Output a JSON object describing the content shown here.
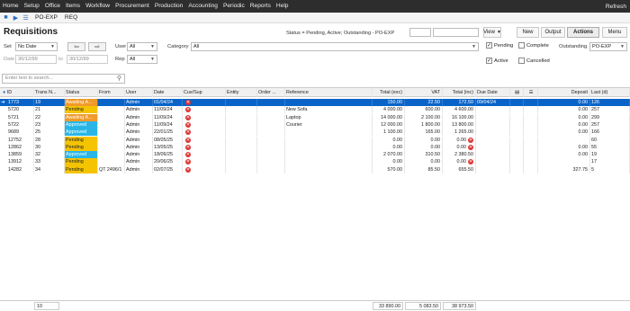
{
  "menubar": {
    "items": [
      "Home",
      "Setup",
      "Office",
      "Items",
      "Workflow",
      "Procurement",
      "Production",
      "Accounting",
      "Periodic",
      "Reports",
      "Help"
    ],
    "refresh": "Refresh"
  },
  "tabs": [
    "PO-EXP",
    "REQ"
  ],
  "header": {
    "title": "Requisitions",
    "status": "Status = Pending, Active; Outstanding - PO-EXP",
    "view_label": "View",
    "new_label": "New",
    "output_label": "Output",
    "actions_label": "Actions",
    "menu_label": "Menu"
  },
  "filters": {
    "set_label": "Set",
    "set_value": "No Date",
    "date_label": "Date",
    "date_from": "30/12/99",
    "to_label": "to",
    "date_to": "30/12/99",
    "user_label": "User",
    "user_value": "All",
    "rep_label": "Rep",
    "rep_value": "All",
    "category_label": "Category",
    "category_value": "All",
    "pending_label": "Pending",
    "pending_checked": true,
    "complete_label": "Complete",
    "complete_checked": false,
    "active_label": "Active",
    "active_checked": true,
    "cancelled_label": "Cancelled",
    "cancelled_checked": false,
    "outstanding_label": "Outstanding",
    "outstanding_value": "PO-EXP"
  },
  "search": {
    "placeholder": "Enter text to search..."
  },
  "columns": [
    "ID",
    "Trans N...",
    "Status",
    "From",
    "User",
    "Date",
    "Cus/Sup",
    "Entity",
    "Order ...",
    "Reference",
    "Total (exc)",
    "VAT",
    "Total (inc)",
    "Due Date",
    "",
    "",
    "Deposit",
    "Last (d)"
  ],
  "rows": [
    {
      "id": "1773",
      "trans": "19",
      "status": "Awaiting A...",
      "status_type": "awaiting",
      "from": "",
      "user": "Admin",
      "date": "01/04/24",
      "cus": true,
      "entity": "",
      "order": "",
      "reference": "",
      "exc": "150.00",
      "vat": "22.50",
      "inc": "172.50",
      "due": "09/04/24",
      "deposit": "0.00",
      "last": "126",
      "selected": true,
      "due_icon": false
    },
    {
      "id": "5720",
      "trans": "21",
      "status": "Pending",
      "status_type": "pending",
      "from": "",
      "user": "Admin",
      "date": "11/09/24",
      "cus": true,
      "entity": "",
      "order": "",
      "reference": "New Sofa",
      "exc": "4 000.00",
      "vat": "600.00",
      "inc": "4 600.00",
      "due": "",
      "deposit": "0.00",
      "last": "257",
      "selected": false,
      "due_icon": false
    },
    {
      "id": "5721",
      "trans": "22",
      "status": "Awaiting A...",
      "status_type": "awaiting",
      "from": "",
      "user": "Admin",
      "date": "11/09/24",
      "cus": true,
      "entity": "",
      "order": "",
      "reference": "Laptop",
      "exc": "14 000.00",
      "vat": "2 100.00",
      "inc": "16 100.00",
      "due": "",
      "deposit": "0.00",
      "last": "299",
      "selected": false,
      "due_icon": false
    },
    {
      "id": "5722",
      "trans": "23",
      "status": "Approved",
      "status_type": "approved",
      "from": "",
      "user": "Admin",
      "date": "11/09/24",
      "cus": true,
      "entity": "",
      "order": "",
      "reference": "Courier",
      "exc": "12 000.00",
      "vat": "1 800.00",
      "inc": "13 800.00",
      "due": "",
      "deposit": "0.00",
      "last": "257",
      "selected": false,
      "due_icon": false
    },
    {
      "id": "9689",
      "trans": "25",
      "status": "Approved",
      "status_type": "approved",
      "from": "",
      "user": "Admin",
      "date": "22/01/25",
      "cus": true,
      "entity": "",
      "order": "",
      "reference": "",
      "exc": "1 100.00",
      "vat": "165.00",
      "inc": "1 265.00",
      "due": "",
      "deposit": "0.00",
      "last": "166",
      "selected": false,
      "due_icon": false
    },
    {
      "id": "12752",
      "trans": "28",
      "status": "Pending",
      "status_type": "pending",
      "from": "",
      "user": "Admin",
      "date": "08/05/25",
      "cus": true,
      "entity": "",
      "order": "",
      "reference": "",
      "exc": "0.00",
      "vat": "0.00",
      "inc": "0.00",
      "due": "",
      "deposit": "",
      "last": "60",
      "selected": false,
      "due_icon": true
    },
    {
      "id": "12862",
      "trans": "30",
      "status": "Pending",
      "status_type": "pending",
      "from": "",
      "user": "Admin",
      "date": "13/05/25",
      "cus": true,
      "entity": "",
      "order": "",
      "reference": "",
      "exc": "0.00",
      "vat": "0.00",
      "inc": "0.00",
      "due": "",
      "deposit": "0.00",
      "last": "55",
      "selected": false,
      "due_icon": true
    },
    {
      "id": "13859",
      "trans": "32",
      "status": "Approved",
      "status_type": "approved",
      "from": "",
      "user": "Admin",
      "date": "18/06/25",
      "cus": true,
      "entity": "",
      "order": "",
      "reference": "",
      "exc": "2 070.00",
      "vat": "310.50",
      "inc": "2 380.50",
      "due": "",
      "deposit": "0.00",
      "last": "19",
      "selected": false,
      "due_icon": false
    },
    {
      "id": "13912",
      "trans": "33",
      "status": "Pending",
      "status_type": "pending",
      "from": "",
      "user": "Admin",
      "date": "20/06/25",
      "cus": true,
      "entity": "",
      "order": "",
      "reference": "",
      "exc": "0.00",
      "vat": "0.00",
      "inc": "0.00",
      "due": "",
      "deposit": "",
      "last": "17",
      "selected": false,
      "due_icon": true
    },
    {
      "id": "14282",
      "trans": "34",
      "status": "Pending",
      "status_type": "pending",
      "from": "QT 2496/1",
      "user": "Admin",
      "date": "02/07/25",
      "cus": true,
      "entity": "",
      "order": "",
      "reference": "",
      "exc": "570.00",
      "vat": "85.50",
      "inc": "655.50",
      "due": "",
      "deposit": "327.75",
      "last": "5",
      "selected": false,
      "due_icon": false
    }
  ],
  "footer": {
    "count": "10",
    "total_exc": "33 890.00",
    "total_vat": "5 083.50",
    "total_inc": "38 973.50"
  },
  "colors": {
    "menubar": "#2d2d2d",
    "selected": "#0a64c8",
    "awaiting": "#f09a2a",
    "pending": "#f5c400",
    "approved": "#29b6e6"
  }
}
